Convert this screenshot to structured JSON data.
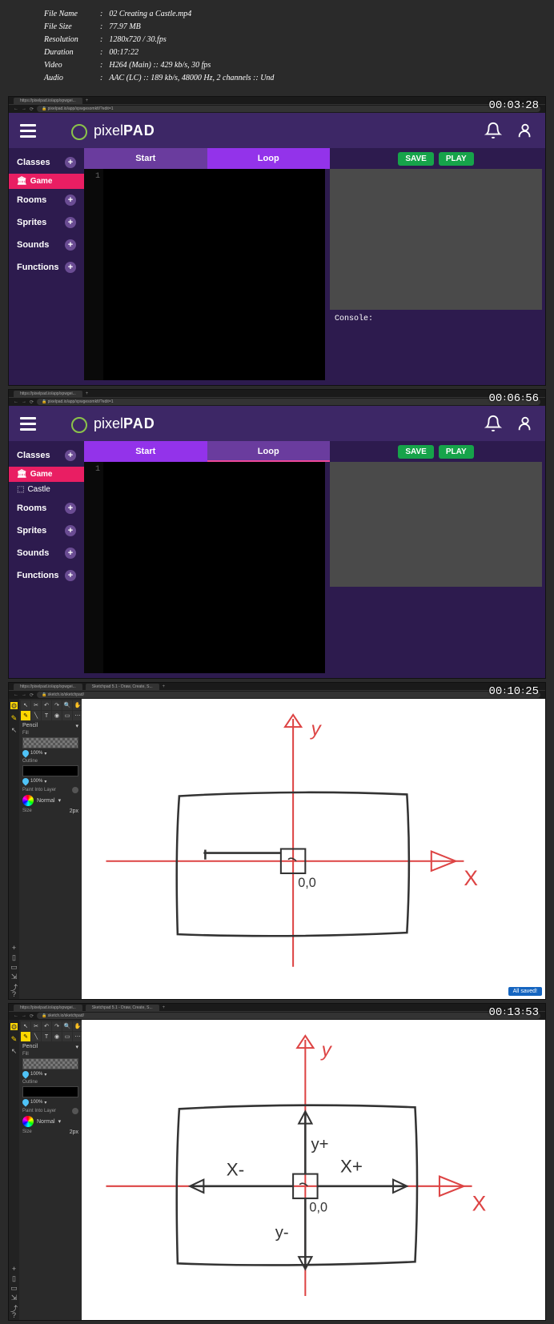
{
  "metadata": {
    "fileName": "02 Creating a Castle.mp4",
    "fileSize": "77.97 MB",
    "resolution": "1280x720 / 30.fps",
    "duration": "00:17:22",
    "video": "H264 (Main) :: 429 kb/s, 30 fps",
    "audio": "AAC (LC) :: 189 kb/s, 48000 Hz, 2 channels :: Und"
  },
  "labels": {
    "fileName": "File Name",
    "fileSize": "File Size",
    "resolution": "Resolution",
    "duration": "Duration",
    "video": "Video",
    "audio": "Audio"
  },
  "timestamps": [
    "00:03:28",
    "00:06:56",
    "00:10:25",
    "00:13:53"
  ],
  "browser": {
    "tab1": "https://pixelpad.io/app/xpwgei...",
    "url1": "pixelpad.io/app/xpwgesomkfi/?edit=1",
    "tab2": "Sketchpad 5.1 - Draw, Create, S...",
    "url2": "sketch.io/sketchpad/"
  },
  "pixelpad": {
    "logo_text": "pixel",
    "logo_bold": "PAD",
    "sidebar": {
      "classes": "Classes",
      "game": "Game",
      "castle": "Castle",
      "rooms": "Rooms",
      "sprites": "Sprites",
      "sounds": "Sounds",
      "functions": "Functions"
    },
    "tabs": {
      "start": "Start",
      "loop": "Loop"
    },
    "lineNum": "1",
    "buttons": {
      "save": "SAVE",
      "play": "PLAY"
    },
    "console": "Console:"
  },
  "sketchpad": {
    "pencil": "Pencil",
    "fill": "Fill",
    "outline": "Outline",
    "paintInto": "Paint Into Layer",
    "normal": "Normal",
    "size": "Size",
    "sizeVal": "2px",
    "opacity": "100%",
    "saved": "All saved!"
  },
  "drawing1": {
    "yLabel": "y",
    "xLabel": "X",
    "origin": "0,0"
  },
  "drawing2": {
    "yLabel": "y",
    "xLabel": "X",
    "yPlus": "y+",
    "yMinus": "y-",
    "xPlus": "X+",
    "xMinus": "X-",
    "origin": "0,0"
  }
}
